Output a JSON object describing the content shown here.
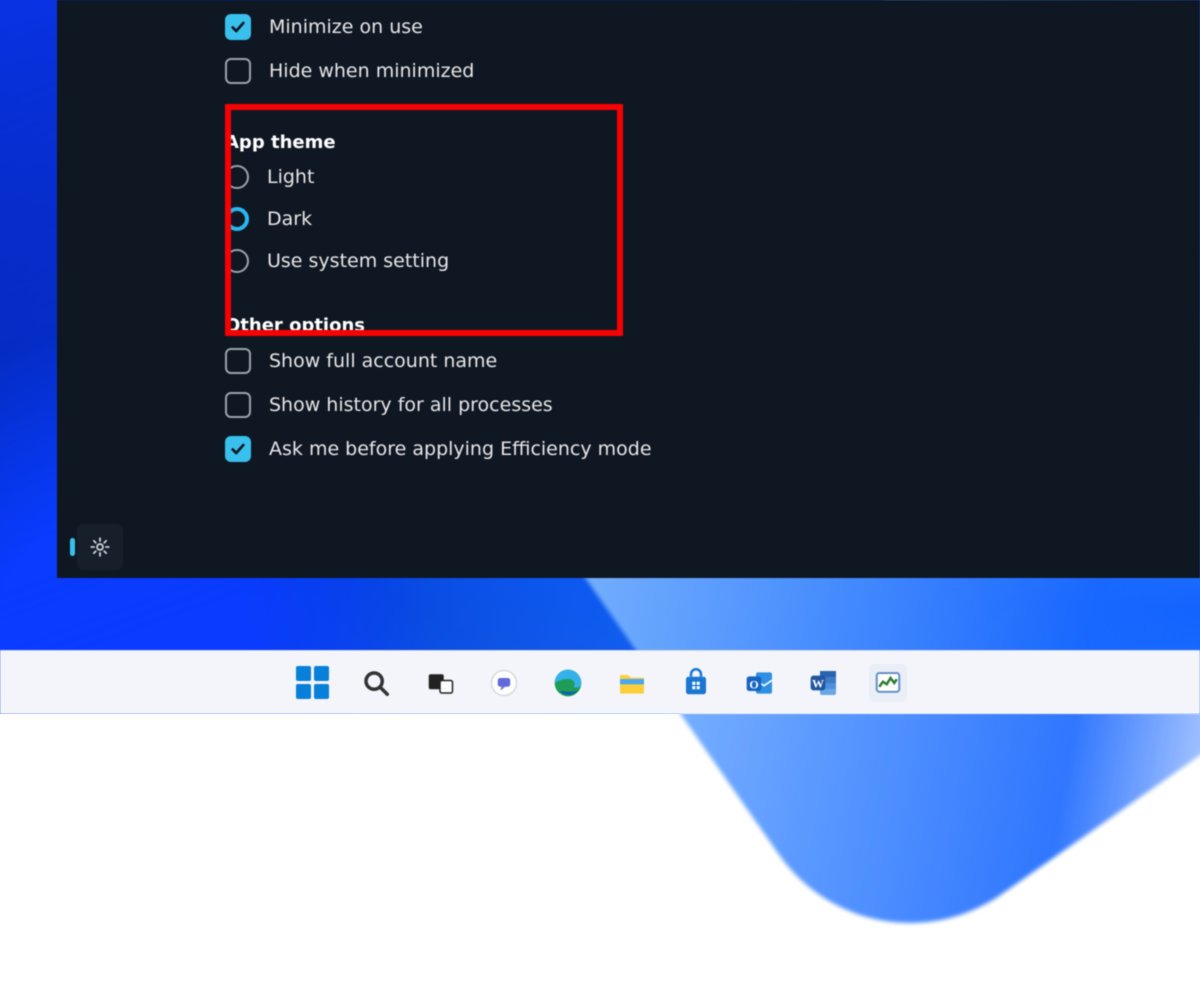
{
  "window_behavior": {
    "minimize_on_use": {
      "label": "Minimize on use",
      "checked": true
    },
    "hide_when_minimized": {
      "label": "Hide when minimized",
      "checked": false
    }
  },
  "app_theme": {
    "heading": "App theme",
    "options": {
      "light": {
        "label": "Light",
        "selected": false
      },
      "dark": {
        "label": "Dark",
        "selected": true
      },
      "system": {
        "label": "Use system setting",
        "selected": false
      }
    }
  },
  "other_options": {
    "heading": "Other options",
    "show_full_account_name": {
      "label": "Show full account name",
      "checked": false
    },
    "show_history_all_processes": {
      "label": "Show history for all processes",
      "checked": false
    },
    "ask_before_efficiency": {
      "label": "Ask me before applying Efficiency mode",
      "checked": true
    }
  },
  "left_rail": {
    "settings": "Settings"
  },
  "taskbar": {
    "start": "Start",
    "search": "Search",
    "task_view": "Task View",
    "chat": "Chat",
    "edge": "Microsoft Edge",
    "explorer": "File Explorer",
    "store": "Microsoft Store",
    "outlook": "Outlook",
    "word": "Word",
    "task_manager": "Task Manager"
  },
  "annotation": {
    "highlight": "App theme section highlighted"
  }
}
